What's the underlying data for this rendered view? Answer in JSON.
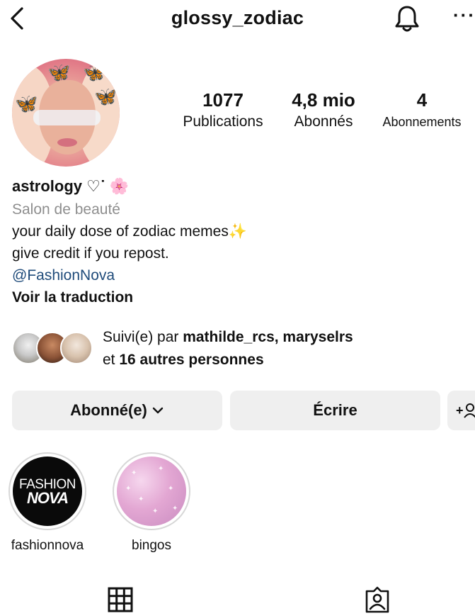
{
  "header": {
    "username": "glossy_zodiac",
    "more_label": "···"
  },
  "stats": [
    {
      "value": "1077",
      "label": "Publications"
    },
    {
      "value": "4,8 mio",
      "label": "Abonnés"
    },
    {
      "value": "4",
      "label": "Abonnements"
    }
  ],
  "bio": {
    "name": "astrology ♡ᐝ",
    "name_emoji": "🌸",
    "category": "Salon de beauté",
    "line1": "your daily dose of zodiac memes",
    "line1_emoji": "✨",
    "line2": "give credit if you repost.",
    "mention": "@FashionNova",
    "translate": "Voir la traduction"
  },
  "followed_by": {
    "prefix": "Suivi(e) par ",
    "users": "mathilde_rcs, maryselrs",
    "and": "et ",
    "others": "16 autres personnes"
  },
  "actions": {
    "follow_label": "Abonné(e)",
    "follow_chevron": "⌄",
    "message_label": "Écrire",
    "add_label": "+"
  },
  "highlights": [
    {
      "label": "fashionnova",
      "logo_top": "FASHION",
      "logo_bottom": "NOVA"
    },
    {
      "label": "bingos"
    }
  ],
  "colors": {
    "link": "#1f4b7a",
    "button_bg": "#efefef",
    "secondary_text": "#8e8e8e"
  },
  "icons": [
    "back-icon",
    "bell-icon",
    "more-icon",
    "chevron-down-icon",
    "add-person-icon",
    "grid-icon",
    "tagged-icon"
  ]
}
